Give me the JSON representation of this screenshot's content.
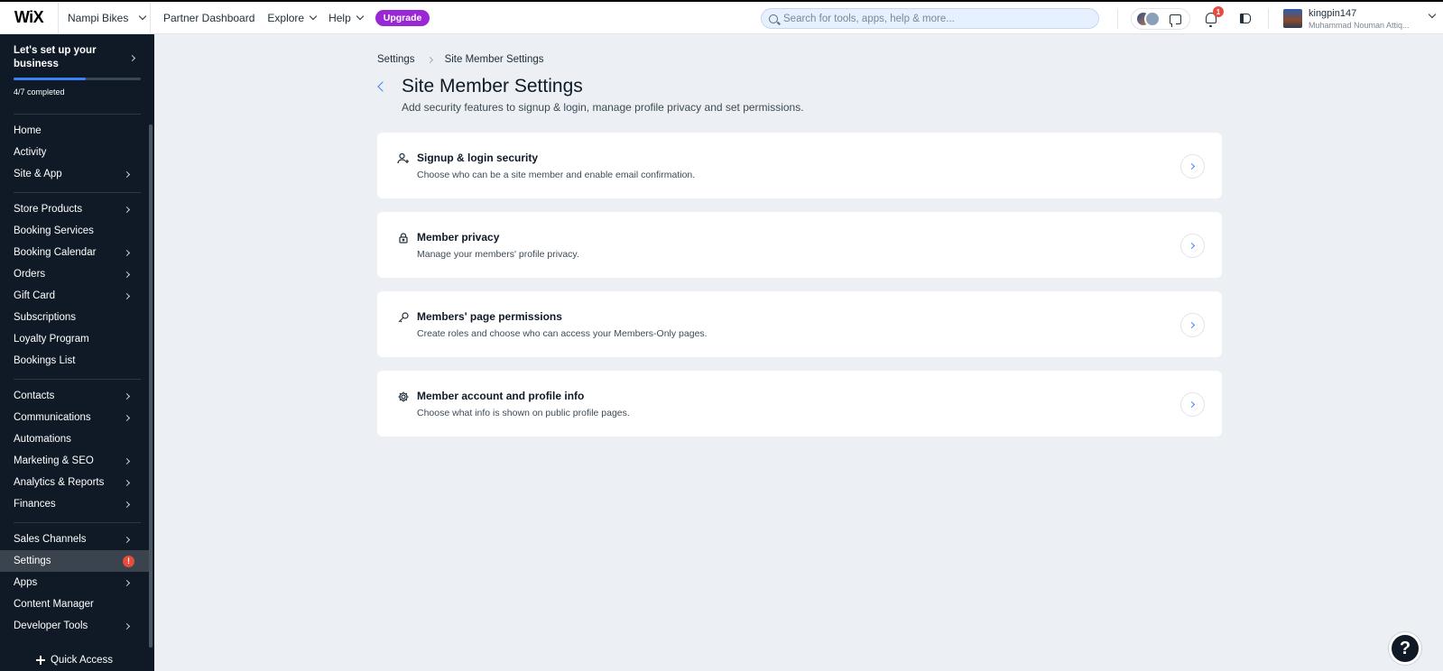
{
  "topbar": {
    "logo": "WiX",
    "site_name": "Nampi Bikes",
    "partner_dashboard": "Partner Dashboard",
    "explore": "Explore",
    "help": "Help",
    "upgrade": "Upgrade",
    "search_placeholder": "Search for tools, apps, help & more...",
    "notification_count": "1",
    "user_name": "kingpin147",
    "user_full_name": "Muhammad Nouman Attiq..."
  },
  "sidebar": {
    "setup_title": "Let's set up your business",
    "setup_progress": 0.57,
    "setup_progress_label": "4/7 completed",
    "groups": [
      [
        {
          "label": "Home",
          "chevron": false
        },
        {
          "label": "Activity",
          "chevron": false
        },
        {
          "label": "Site & App",
          "chevron": true
        }
      ],
      [
        {
          "label": "Store Products",
          "chevron": true
        },
        {
          "label": "Booking Services",
          "chevron": false
        },
        {
          "label": "Booking Calendar",
          "chevron": true
        },
        {
          "label": "Orders",
          "chevron": true
        },
        {
          "label": "Gift Card",
          "chevron": true
        },
        {
          "label": "Subscriptions",
          "chevron": false
        },
        {
          "label": "Loyalty Program",
          "chevron": false
        },
        {
          "label": "Bookings List",
          "chevron": false
        }
      ],
      [
        {
          "label": "Contacts",
          "chevron": true
        },
        {
          "label": "Communications",
          "chevron": true
        },
        {
          "label": "Automations",
          "chevron": false
        },
        {
          "label": "Marketing & SEO",
          "chevron": true
        },
        {
          "label": "Analytics & Reports",
          "chevron": true
        },
        {
          "label": "Finances",
          "chevron": true
        }
      ],
      [
        {
          "label": "Sales Channels",
          "chevron": true
        },
        {
          "label": "Settings",
          "chevron": false,
          "active": true,
          "alert": "!"
        },
        {
          "label": "Apps",
          "chevron": true
        },
        {
          "label": "Content Manager",
          "chevron": false
        },
        {
          "label": "Developer Tools",
          "chevron": true
        }
      ]
    ],
    "quick_access": "Quick Access"
  },
  "main": {
    "breadcrumb": [
      "Settings",
      "Site Member Settings"
    ],
    "title": "Site Member Settings",
    "subtitle": "Add security features to signup & login, manage profile privacy and set permissions.",
    "cards": [
      {
        "icon": "user-plus-icon",
        "title": "Signup & login security",
        "desc": "Choose who can be a site member and enable email confirmation."
      },
      {
        "icon": "lock-icon",
        "title": "Member privacy",
        "desc": "Manage your members' profile privacy."
      },
      {
        "icon": "key-icon",
        "title": "Members' page permissions",
        "desc": "Create roles and choose who can access your Members-Only pages."
      },
      {
        "icon": "gear-icon",
        "title": "Member account and profile info",
        "desc": "Choose what info is shown on public profile pages."
      }
    ]
  },
  "help_button": "?",
  "colors": {
    "accent": "#3b82f6",
    "upgrade": "#9a27d5",
    "sidebar_bg": "#0f1a26",
    "alert": "#e64c3c"
  }
}
